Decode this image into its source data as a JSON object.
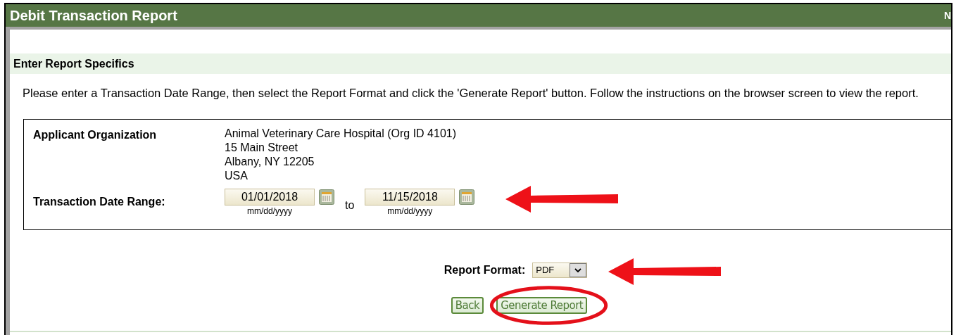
{
  "header": {
    "title": "Debit Transaction Report",
    "right_text": "N"
  },
  "section": {
    "title": "Enter Report Specifics"
  },
  "instructions": "Please enter a Transaction Date Range, then select the Report Format and click the 'Generate Report' button. Follow the instructions on the browser screen to view the report.",
  "organization": {
    "label": "Applicant Organization",
    "lines": [
      "Animal Veterinary Care Hospital (Org ID 4101)",
      "15 Main Street",
      "Albany, NY 12205",
      "USA"
    ]
  },
  "date_range": {
    "label": "Transaction Date Range:",
    "from": {
      "value": "01/01/2018",
      "hint": "mm/dd/yyyy"
    },
    "separator": "to",
    "to": {
      "value": "11/15/2018",
      "hint": "mm/dd/yyyy"
    }
  },
  "report_format": {
    "label": "Report Format:",
    "value": "PDF"
  },
  "buttons": [
    {
      "label": "Back",
      "highlighted": false
    },
    {
      "label": "Generate Report",
      "highlighted": true
    }
  ]
}
